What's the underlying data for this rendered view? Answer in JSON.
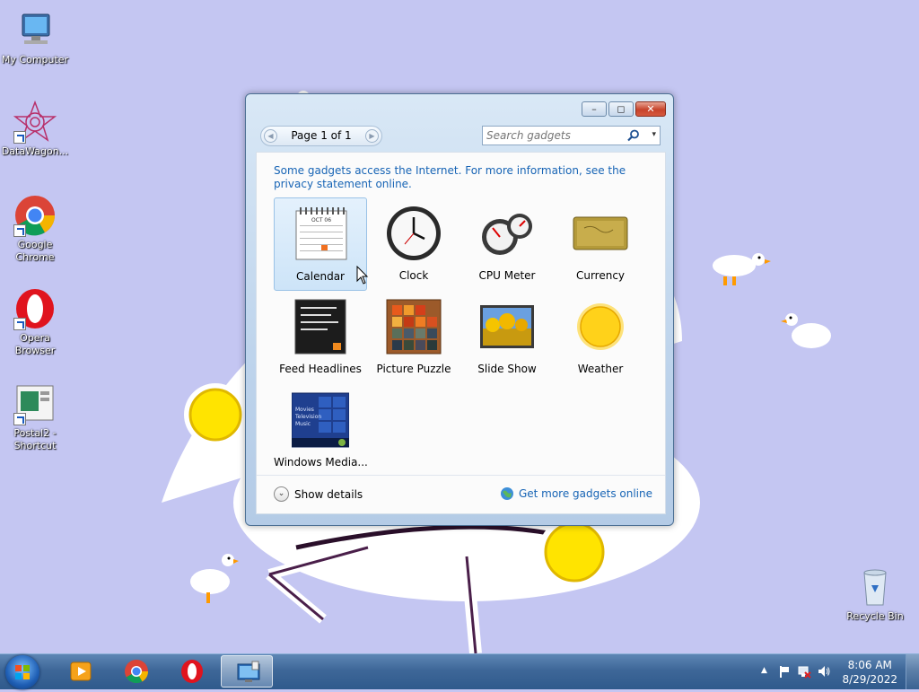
{
  "desktop": {
    "icons": [
      {
        "label": "My Computer",
        "icon": "computer-icon"
      },
      {
        "label": "DataWagon...",
        "icon": "datawagon-icon"
      },
      {
        "label": "Google Chrome",
        "icon": "chrome-icon"
      },
      {
        "label": "Opera Browser",
        "icon": "opera-icon"
      },
      {
        "label": "Postal2 - Shortcut",
        "icon": "postal2-icon"
      },
      {
        "label": "Recycle Bin",
        "icon": "recycle-bin-icon"
      }
    ]
  },
  "gadget_window": {
    "controls": {
      "minimize": "–",
      "restore": "◻",
      "close": "✕"
    },
    "pager": {
      "prev": "◀",
      "label": "Page 1 of 1",
      "next": "▶"
    },
    "search": {
      "placeholder": "Search gadgets",
      "dropdown": "▾"
    },
    "notice": "Some gadgets access the Internet.  For more information, see the privacy statement online.",
    "gadgets": [
      {
        "name": "Calendar",
        "selected": true
      },
      {
        "name": "Clock",
        "selected": false
      },
      {
        "name": "CPU Meter",
        "selected": false
      },
      {
        "name": "Currency",
        "selected": false
      },
      {
        "name": "Feed Headlines",
        "selected": false
      },
      {
        "name": "Picture Puzzle",
        "selected": false
      },
      {
        "name": "Slide Show",
        "selected": false
      },
      {
        "name": "Weather",
        "selected": false
      },
      {
        "name": "Windows Media...",
        "selected": false
      }
    ],
    "calendar_thumb": {
      "month": "OCT 06"
    },
    "media_thumb": {
      "lines": [
        "Movies",
        "Television",
        "Music"
      ]
    },
    "show_details": {
      "label": "Show details",
      "chevron": "⌄"
    },
    "get_more": "Get more gadgets online"
  },
  "taskbar": {
    "pinned": [
      "media-player-icon",
      "chrome-icon",
      "opera-icon",
      "gadgets-icon"
    ],
    "tray": {
      "show_hidden": "▲",
      "time": "8:06 AM",
      "date": "8/29/2022"
    }
  },
  "colors": {
    "accent_link": "#1764b5",
    "wallpaper": "#c4c6f2",
    "taskbar": "#3e6798"
  }
}
